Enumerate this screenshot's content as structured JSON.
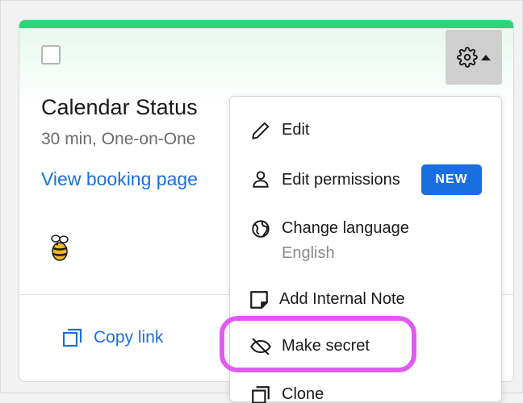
{
  "card": {
    "title": "Calendar Status",
    "meta": "30 min, One-on-One",
    "booking_link": "View booking page",
    "copy_link": "Copy link"
  },
  "menu": {
    "items": [
      {
        "label": "Edit",
        "icon": "pencil-icon"
      },
      {
        "label": "Edit permissions",
        "icon": "user-icon",
        "badge": "NEW"
      },
      {
        "label": "Change language",
        "icon": "globe-icon",
        "sub": "English"
      },
      {
        "label": "Add Internal Note",
        "icon": "note-icon"
      },
      {
        "label": "Make secret",
        "icon": "eye-off-icon"
      },
      {
        "label": "Clone",
        "icon": "clone-icon"
      }
    ]
  },
  "colors": {
    "accent_bar": "#2ed47a",
    "link": "#1a6fe0",
    "badge": "#1a6fe0",
    "highlight": "#e05cf0"
  }
}
